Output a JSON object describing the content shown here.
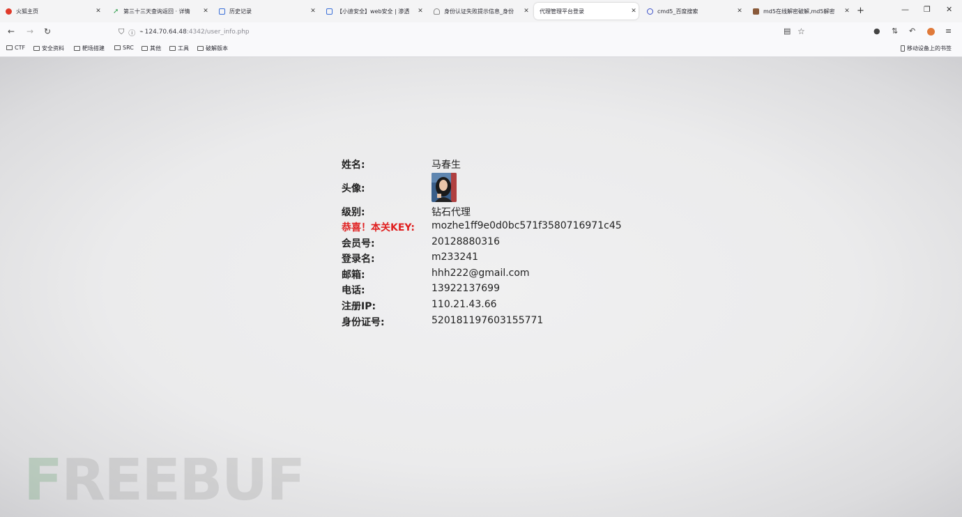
{
  "browser": {
    "tabs": [
      {
        "title": "火狐主页",
        "favicon_color": "#e03a2a"
      },
      {
        "title": "第三十三天查询返回 · 详情",
        "favicon_color": "#2e9e4a"
      },
      {
        "title": "历史记录",
        "favicon_color": "#3a6fd8"
      },
      {
        "title": "【小迪安全】web安全 | 渗透",
        "favicon_color": "#3a6fd8"
      },
      {
        "title": "身份认证失败提示信息_身份",
        "favicon_color": "#888888"
      },
      {
        "title": "代理管理平台登录",
        "favicon_color": "#999999",
        "active": true
      },
      {
        "title": "cmd5_百度搜索",
        "favicon_color": "#3a4fc8"
      },
      {
        "title": "md5在线解密破解,md5解密",
        "favicon_color": "#8a5a3a"
      }
    ],
    "url": {
      "host": "124.70.64.48",
      "path": ":4342/user_info.php"
    },
    "bookmarks": [
      "CTF",
      "安全资料",
      "靶场搭建",
      "SRC",
      "其他",
      "工具",
      "破解版本"
    ],
    "mobile_bookmarks": "移动设备上的书签"
  },
  "profile": {
    "name": {
      "label": "姓名:",
      "value": "马春生"
    },
    "avatar": {
      "label": "头像:"
    },
    "level": {
      "label": "级别:",
      "value": "钻石代理"
    },
    "key": {
      "label": "恭喜！本关KEY:",
      "value": "mozhe1ff9e0d0bc571f3580716971c45"
    },
    "member_id": {
      "label": "会员号:",
      "value": "20128880316"
    },
    "login_name": {
      "label": "登录名:",
      "value": "m233241"
    },
    "email": {
      "label": "邮箱:",
      "value": "hhh222@gmail.com"
    },
    "phone": {
      "label": "电话:",
      "value": "13922137699"
    },
    "reg_ip": {
      "label": "注册IP:",
      "value": "110.21.43.66"
    },
    "id_card": {
      "label": "身份证号:",
      "value": "520181197603155771"
    }
  },
  "watermark": {
    "first": "F",
    "rest": "REEBUF"
  },
  "colors": {
    "key_label": "#e02020",
    "text": "#222222"
  }
}
